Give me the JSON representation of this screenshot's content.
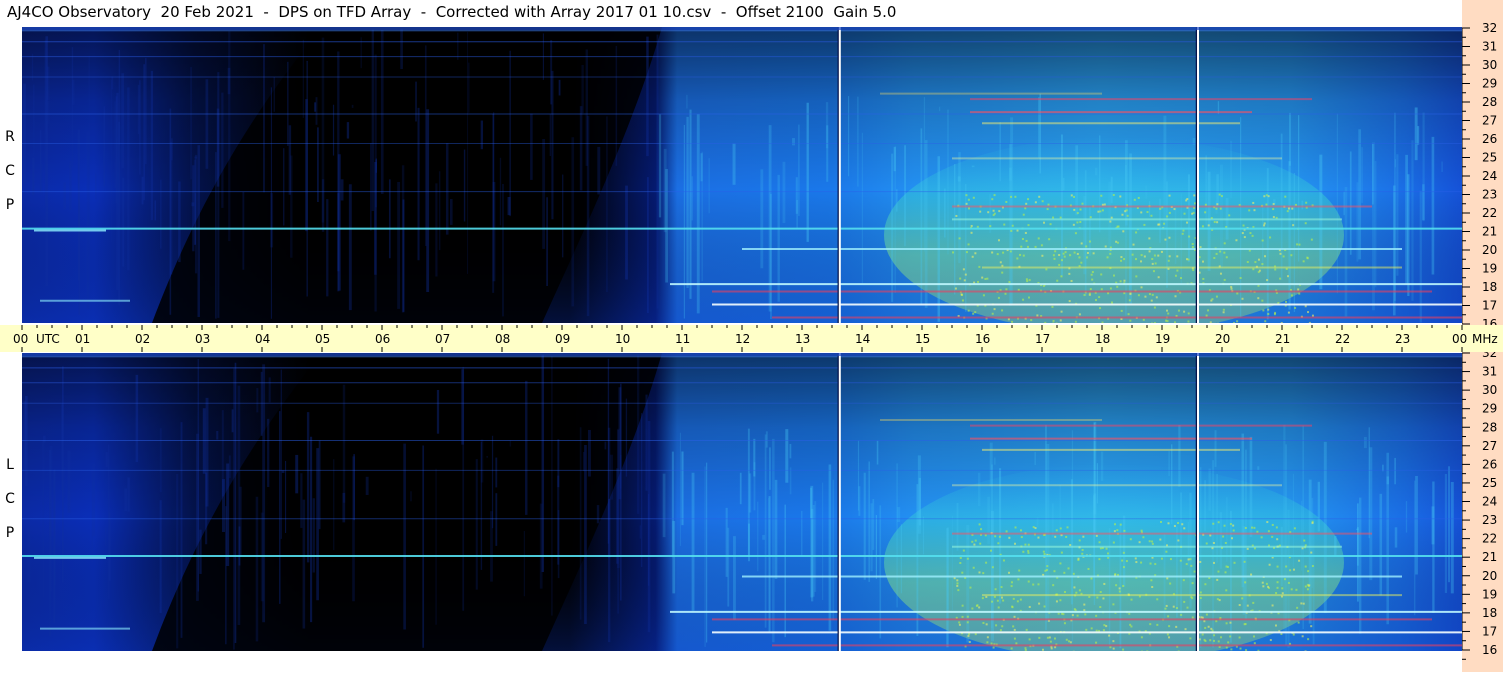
{
  "title": "AJ4CO Observatory  20 Feb 2021  -  DPS on TFD Array  -  Corrected with Array 2017 01 10.csv  -  Offset 2100  Gain 5.0",
  "panels": [
    {
      "id": "rcp",
      "label": [
        "R",
        "C",
        "P"
      ]
    },
    {
      "id": "lcp",
      "label": [
        "L",
        "C",
        "P"
      ]
    }
  ],
  "time_axis": {
    "ticks": [
      "00",
      "01",
      "02",
      "03",
      "04",
      "05",
      "06",
      "07",
      "08",
      "09",
      "10",
      "11",
      "12",
      "13",
      "14",
      "15",
      "16",
      "17",
      "18",
      "19",
      "20",
      "21",
      "22",
      "23",
      "00"
    ],
    "unit_left": "UTC",
    "unit_right": "MHz"
  },
  "freq_axis": {
    "ticks": [
      "32",
      "31",
      "30",
      "29",
      "28",
      "27",
      "26",
      "25",
      "24",
      "23",
      "22",
      "21",
      "20",
      "19",
      "18",
      "17",
      "16"
    ]
  },
  "chart_data": {
    "type": "heatmap",
    "title": "AJ4CO Observatory  20 Feb 2021  -  DPS on TFD Array  -  Corrected with Array 2017 01 10.csv  -  Offset 2100  Gain 5.0",
    "x": {
      "label": "UTC",
      "range": [
        0,
        24
      ],
      "ticks": [
        "00",
        "01",
        "02",
        "03",
        "04",
        "05",
        "06",
        "07",
        "08",
        "09",
        "10",
        "11",
        "12",
        "13",
        "14",
        "15",
        "16",
        "17",
        "18",
        "19",
        "20",
        "21",
        "22",
        "23",
        "00"
      ]
    },
    "y": {
      "label": "MHz",
      "range": [
        16,
        32
      ],
      "ticks": [
        32,
        31,
        30,
        29,
        28,
        27,
        26,
        25,
        24,
        23,
        22,
        21,
        20,
        19,
        18,
        17,
        16
      ]
    },
    "panels": [
      "RCP",
      "LCP"
    ],
    "colors": {
      "low": "#000000",
      "mid": "#1560e0",
      "high": "#2ad0f0",
      "peak": "#e8f040",
      "spike": "#ff2040"
    }
  }
}
